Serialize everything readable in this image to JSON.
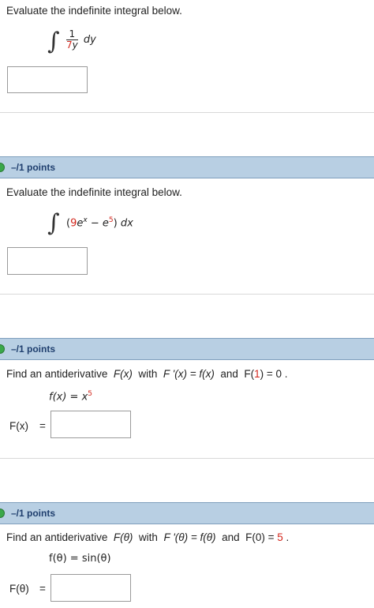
{
  "q1": {
    "prompt": "Evaluate the indefinite integral below.",
    "integral_sign": "∫",
    "numerator": "1",
    "denominator_coef": "7",
    "denominator_var": "y",
    "differential": "dy",
    "answer": ""
  },
  "q2": {
    "points_label": "–/1 points",
    "prompt": "Evaluate the indefinite integral below.",
    "integral_sign": "∫",
    "open_paren": "(",
    "coef": "9",
    "base1": "e",
    "exp1": "x",
    "minus": "−",
    "base2": "e",
    "exp2": "5",
    "close_paren": ")",
    "differential": "dx",
    "answer": ""
  },
  "q3": {
    "points_label": "–/1 points",
    "prompt_part1": "Find an antiderivative",
    "fx_label": "F(x)",
    "with": "with",
    "fprime_label": "F '(x) = f(x)",
    "and": "and",
    "cond_lhs": "F(",
    "cond_arg": "1",
    "cond_rhs": ") = 0 .",
    "given_lhs": "f(x) = x",
    "given_exp": "5",
    "answer_label": "F(x)",
    "equals": "=",
    "answer": ""
  },
  "q4": {
    "points_label": "–/1 points",
    "prompt_part1": "Find an antiderivative",
    "fx_label": "F(θ)",
    "with": "with",
    "fprime_label": "F '(θ) = f(θ)",
    "and": "and",
    "cond_lhs": "F(0) = ",
    "cond_val": "5",
    "cond_end": " .",
    "given": "f(θ) = sin(θ)",
    "answer_label": "F(θ)",
    "equals": "=",
    "answer": ""
  },
  "colors": {
    "points_bar": "#b8cfe3",
    "points_text": "#1f3f6e",
    "status_dot": "#3aa84a",
    "highlight": "#d3261c"
  }
}
